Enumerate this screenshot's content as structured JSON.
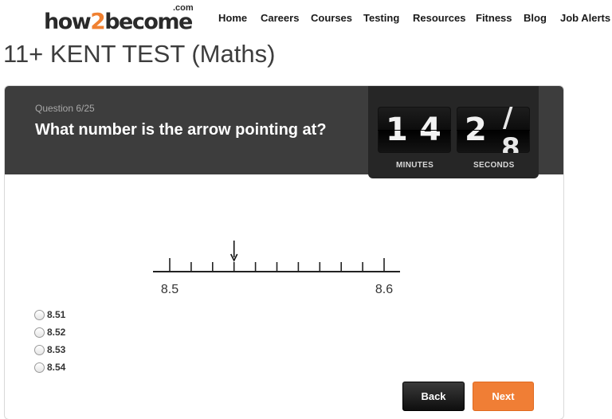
{
  "header": {
    "logo": {
      "prefix": "how",
      "two": "2",
      "suffix": "become",
      "tld": ".com"
    },
    "nav": [
      "Home",
      "Careers",
      "Courses",
      "Testing",
      "Resources",
      "Fitness",
      "Blog",
      "Job Alerts"
    ]
  },
  "page_title": "11+ KENT TEST (Maths)",
  "quiz": {
    "question_number": "Question 6/25",
    "question_text": "What number is the arrow pointing at?",
    "number_line": {
      "start_label": "8.5",
      "end_label": "8.6",
      "start_value": 8.5,
      "end_value": 8.6,
      "divisions": 10,
      "arrow_value": 8.53
    },
    "options": [
      "8.51",
      "8.52",
      "8.53",
      "8.54"
    ],
    "back_label": "Back",
    "next_label": "Next"
  },
  "timer": {
    "minutes": [
      "1",
      "4"
    ],
    "seconds": [
      "2",
      "/"
    ],
    "seconds_flip_next": "8",
    "minutes_label": "MINUTES",
    "seconds_label": "SECONDS"
  },
  "colors": {
    "accent": "#f07e35",
    "header_bar": "#3d3d3d",
    "timer_bg": "#262626"
  }
}
